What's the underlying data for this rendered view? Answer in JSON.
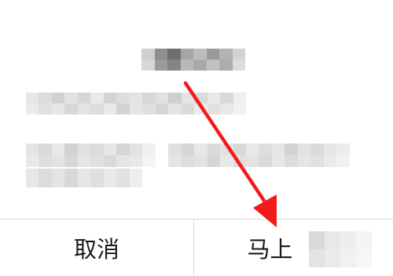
{
  "dialog": {
    "title_redacted": true,
    "message_lines_redacted": 2
  },
  "buttons": {
    "cancel_label": "取消",
    "confirm_label_visible": "马上"
  },
  "annotation": {
    "arrow_color": "#f21b1b",
    "arrow_target": "confirm-button"
  },
  "colors": {
    "divider": "#dadada",
    "text": "#1a1a1a",
    "background": "#ffffff"
  }
}
